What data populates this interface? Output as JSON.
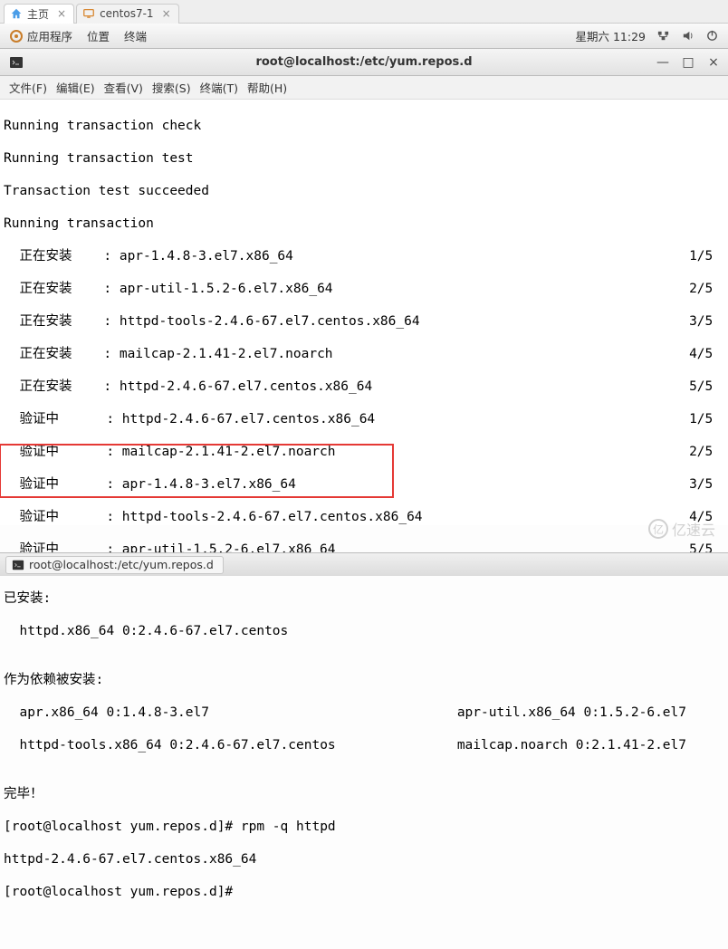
{
  "outer_tabs": {
    "home": {
      "label": "主页"
    },
    "vm": {
      "label": "centos7-1"
    }
  },
  "gnome": {
    "apps": "应用程序",
    "places": "位置",
    "terminal": "终端",
    "datetime": "星期六 11:29"
  },
  "window": {
    "title": "root@localhost:/etc/yum.repos.d",
    "btn_min": "—",
    "btn_max": "□",
    "btn_close": "×"
  },
  "menu": {
    "file": "文件(F)",
    "edit": "编辑(E)",
    "view": "查看(V)",
    "search": "搜索(S)",
    "terminal": "终端(T)",
    "help": "帮助(H)"
  },
  "term": {
    "l0": "Running transaction check",
    "l1": "Running transaction test",
    "l2": "Transaction test succeeded",
    "l3": "Running transaction",
    "rows": [
      {
        "l": "  正在安装    : apr-1.4.8-3.el7.x86_64",
        "r": "1/5 "
      },
      {
        "l": "  正在安装    : apr-util-1.5.2-6.el7.x86_64",
        "r": "2/5 "
      },
      {
        "l": "  正在安装    : httpd-tools-2.4.6-67.el7.centos.x86_64",
        "r": "3/5 "
      },
      {
        "l": "  正在安装    : mailcap-2.1.41-2.el7.noarch",
        "r": "4/5 "
      },
      {
        "l": "  正在安装    : httpd-2.4.6-67.el7.centos.x86_64",
        "r": "5/5 "
      },
      {
        "l": "  验证中      : httpd-2.4.6-67.el7.centos.x86_64",
        "r": "1/5 "
      },
      {
        "l": "  验证中      : mailcap-2.1.41-2.el7.noarch",
        "r": "2/5 "
      },
      {
        "l": "  验证中      : apr-1.4.8-3.el7.x86_64",
        "r": "3/5 "
      },
      {
        "l": "  验证中      : httpd-tools-2.4.6-67.el7.centos.x86_64",
        "r": "4/5 "
      },
      {
        "l": "  验证中      : apr-util-1.5.2-6.el7.x86_64",
        "r": "5/5 "
      }
    ],
    "blank": "",
    "installed_hdr": "已安装:",
    "installed_line": "  httpd.x86_64 0:2.4.6-67.el7.centos",
    "dep_hdr": "作为依赖被安装:",
    "dep_l1_a": "  apr.x86_64 0:1.4.8-3.el7",
    "dep_l1_b": "apr-util.x86_64 0:1.5.2-6.el7",
    "dep_l2_a": "  httpd-tools.x86_64 0:2.4.6-67.el7.centos",
    "dep_l2_b": "mailcap.noarch 0:2.1.41-2.el7",
    "done": "完毕！",
    "prompt1": "[root@localhost yum.repos.d]# rpm -q httpd",
    "rpm_out": "httpd-2.4.6-67.el7.centos.x86_64",
    "prompt2": "[root@localhost yum.repos.d]# "
  },
  "taskbar": {
    "item1": "root@localhost:/etc/yum.repos.d"
  },
  "watermark": {
    "text": "亿速云"
  }
}
